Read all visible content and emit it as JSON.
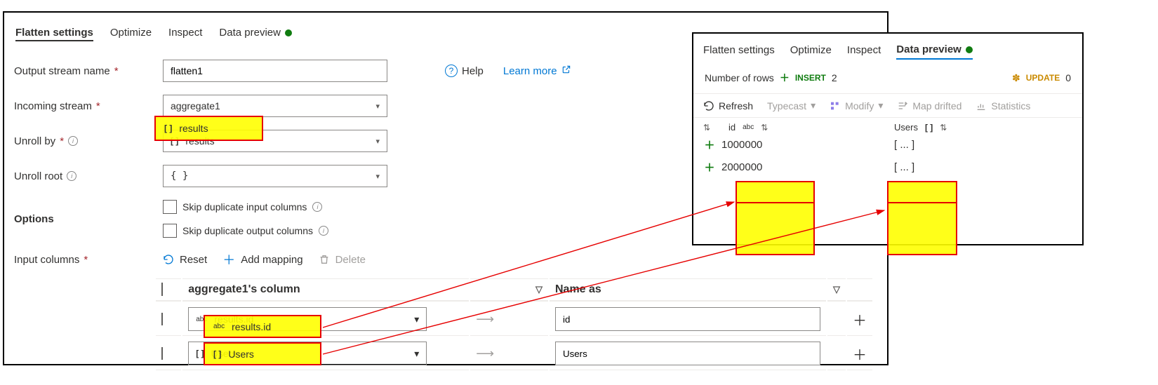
{
  "main_tabs": {
    "flatten": "Flatten settings",
    "optimize": "Optimize",
    "inspect": "Inspect",
    "data_preview": "Data preview"
  },
  "form": {
    "output_stream_label": "Output stream name",
    "output_stream_value": "flatten1",
    "incoming_stream_label": "Incoming stream",
    "incoming_stream_value": "aggregate1",
    "unroll_by_label": "Unroll by",
    "unroll_by_value": "results",
    "unroll_root_label": "Unroll root",
    "unroll_root_value": "{ }",
    "options_label": "Options",
    "skip_dup_input_label": "Skip duplicate input columns",
    "skip_dup_output_label": "Skip duplicate output columns",
    "input_columns_label": "Input columns"
  },
  "help_link": "Help",
  "learn_more": "Learn more",
  "toolbar": {
    "reset": "Reset",
    "add_mapping": "Add mapping",
    "delete": "Delete"
  },
  "table": {
    "col_source": "aggregate1's column",
    "col_name": "Name as",
    "rows": [
      {
        "source": "results.id",
        "source_type": "abc",
        "name": "id"
      },
      {
        "source": "Users",
        "source_type": "arr",
        "name": "Users"
      }
    ]
  },
  "overlay": {
    "tabs": {
      "flatten": "Flatten settings",
      "optimize": "Optimize",
      "inspect": "Inspect",
      "data_preview": "Data preview"
    },
    "rows_label": "Number of rows",
    "insert_label": "INSERT",
    "insert_count": "2",
    "update_label": "UPDATE",
    "update_count": "0",
    "cmds": {
      "refresh": "Refresh",
      "typecast": "Typecast",
      "modify": "Modify",
      "map_drifted": "Map drifted",
      "statistics": "Statistics"
    },
    "columns": {
      "id_label": "id",
      "users_label": "Users"
    },
    "data_rows": [
      {
        "id": "1000000",
        "users": "[ ... ]"
      },
      {
        "id": "2000000",
        "users": "[ ... ]"
      }
    ]
  }
}
